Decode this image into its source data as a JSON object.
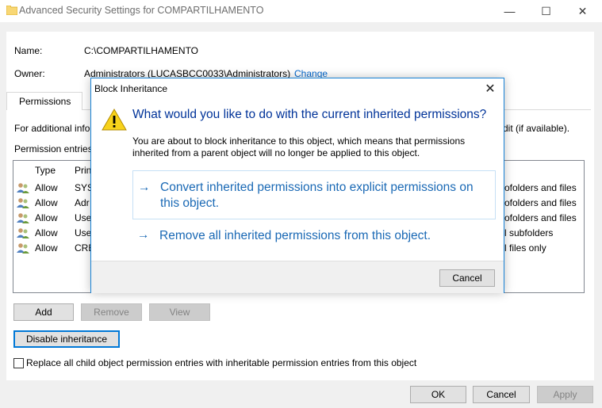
{
  "window": {
    "title": "Advanced Security Settings for COMPARTILHAMENTO",
    "minimize_glyph": "—",
    "maximize_glyph": "☐",
    "close_glyph": "✕"
  },
  "props": {
    "name_label": "Name:",
    "name_value": "C:\\COMPARTILHAMENTO",
    "owner_label": "Owner:",
    "owner_value": "Administrators (LUCASBCC0033\\Administrators)",
    "change_link": "Change"
  },
  "tabs": [
    {
      "label": "Permissions"
    }
  ],
  "info": {
    "line_left": "For additional info",
    "line_right": "dit (if available).",
    "entries_label": "Permission entries"
  },
  "table": {
    "headers": [
      "Type",
      "Prin"
    ],
    "rows": [
      {
        "type": "Allow",
        "principal": "SYS",
        "applies": "ofolders and files"
      },
      {
        "type": "Allow",
        "principal": "Adr",
        "applies": "ofolders and files"
      },
      {
        "type": "Allow",
        "principal": "Use",
        "applies": "ofolders and files"
      },
      {
        "type": "Allow",
        "principal": "Use",
        "applies": "l subfolders"
      },
      {
        "type": "Allow",
        "principal": "CRE",
        "applies": "l files only"
      }
    ]
  },
  "buttons": {
    "add": "Add",
    "remove": "Remove",
    "view": "View",
    "disable_inheritance": "Disable inheritance",
    "ok": "OK",
    "cancel": "Cancel",
    "apply": "Apply"
  },
  "replace_checkbox": {
    "label": "Replace all child object permission entries with inheritable permission entries from this object",
    "checked": false
  },
  "dialog": {
    "title": "Block Inheritance",
    "close_glyph": "✕",
    "question": "What would you like to do with the current inherited permissions?",
    "description": "You are about to block inheritance to this object, which means that permissions inherited from a parent object will no longer be applied to this object.",
    "option1": "Convert inherited permissions into explicit permissions on this object.",
    "option2": "Remove all inherited permissions from this object.",
    "arrow_glyph": "→",
    "cancel": "Cancel"
  },
  "colors": {
    "accent": "#0078d7",
    "link": "#0066cc",
    "heading": "#003399",
    "command_link": "#1a69b5",
    "warning_yellow": "#f7d21b"
  }
}
